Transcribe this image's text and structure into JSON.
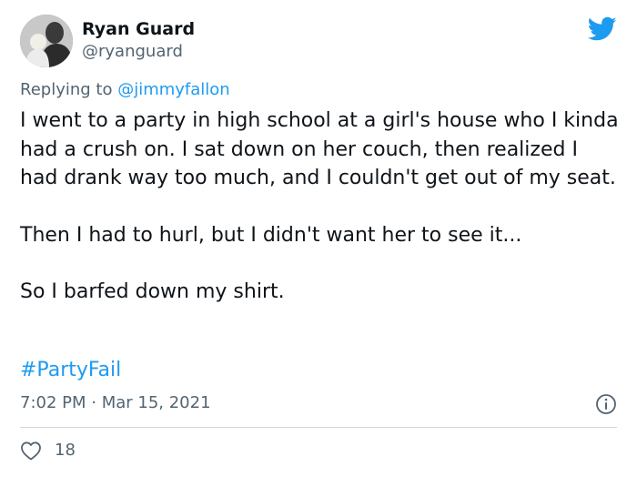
{
  "tweet": {
    "author": {
      "display_name": "Ryan Guard",
      "handle": "@ryanguard",
      "avatar_icon": "profile-photo"
    },
    "brand_icon": "twitter-bird-icon",
    "brand_color": "#1d9bf0",
    "reply": {
      "prefix": "Replying to ",
      "mention": "@jimmyfallon"
    },
    "paragraphs": [
      "I went to a party in high school at a girl's house who I kinda had a crush on. I sat down on her couch, then realized I had drank way too much, and I couldn't get out of my seat.",
      "Then I had to hurl, but I didn't want her to see it...",
      "So I barfed down my shirt."
    ],
    "hashtag": "#PartyFail",
    "timestamp": "7:02 PM · Mar 15, 2021",
    "info_icon": "info-icon",
    "like_icon": "heart-icon",
    "like_count": "18"
  }
}
